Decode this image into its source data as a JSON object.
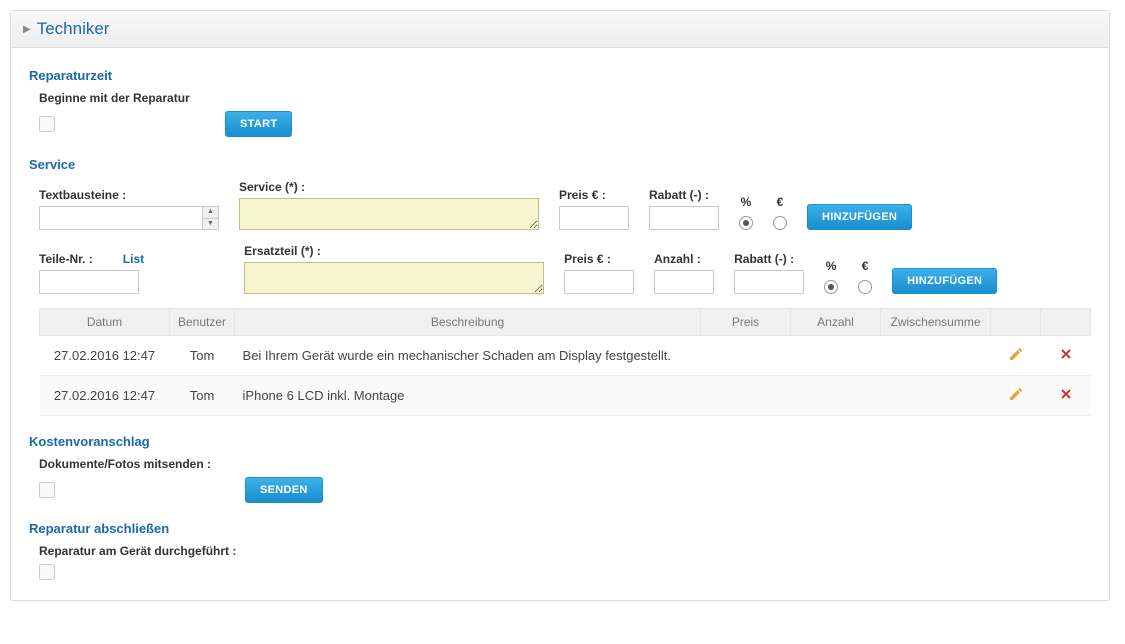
{
  "panel": {
    "title": "Techniker"
  },
  "repairTime": {
    "title": "Reparaturzeit",
    "beginLabel": "Beginne mit der Reparatur",
    "startButton": "START"
  },
  "service": {
    "title": "Service",
    "textblocksLabel": "Textbausteine :",
    "serviceLabel": "Service (*) :",
    "priceLabel": "Preis € :",
    "discountLabel": "Rabatt (-) :",
    "percentLabel": "%",
    "euroLabel": "€",
    "addButton": "HINZUFÜGEN",
    "partNrLabel": "Teile-Nr. :",
    "listLink": "List",
    "sparePartLabel": "Ersatzteil (*) :",
    "anzahlLabel": "Anzahl :",
    "discountLabel2": "Rabatt (-) :",
    "addButton2": "HINZUFÜGEN"
  },
  "tableHeaders": {
    "datum": "Datum",
    "benutzer": "Benutzer",
    "beschreibung": "Beschreibung",
    "preis": "Preis",
    "anzahl": "Anzahl",
    "zwischensumme": "Zwischensumme"
  },
  "rows": [
    {
      "datum": "27.02.2016 12:47",
      "benutzer": "Tom",
      "beschreibung": "Bei Ihrem Gerät wurde ein mechanischer Schaden am Display festgestellt.",
      "preis": "",
      "anzahl": "",
      "zwischensumme": ""
    },
    {
      "datum": "27.02.2016 12:47",
      "benutzer": "Tom",
      "beschreibung": "iPhone 6 LCD inkl. Montage",
      "preis": "",
      "anzahl": "",
      "zwischensumme": ""
    }
  ],
  "estimate": {
    "title": "Kostenvoranschlag",
    "docsLabel": "Dokumente/Fotos mitsenden :",
    "sendButton": "SENDEN"
  },
  "finish": {
    "title": "Reparatur abschließen",
    "doneLabel": "Reparatur am Gerät durchgeführt :"
  }
}
